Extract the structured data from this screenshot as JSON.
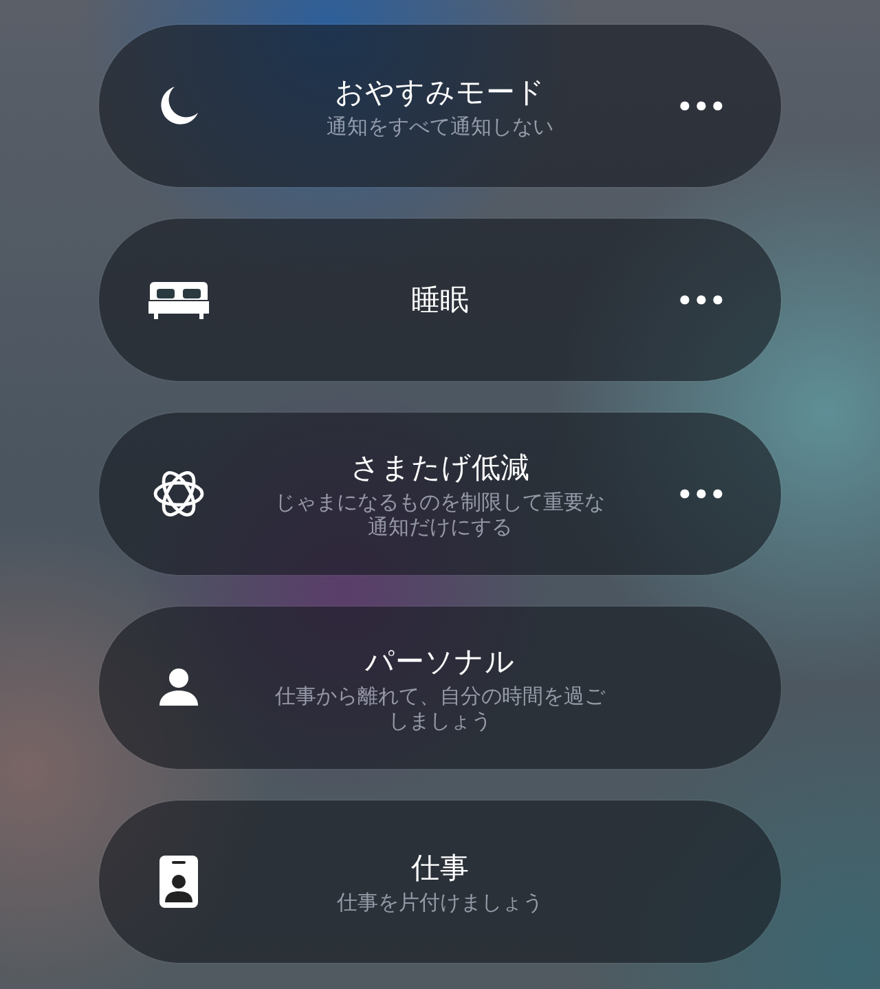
{
  "focus_modes": [
    {
      "kind": "moon",
      "title": "おやすみモード",
      "subtitle": "通知をすべて通知しない",
      "more_button": true
    },
    {
      "kind": "bed",
      "title": "睡眠",
      "more_button": true
    },
    {
      "kind": "atom",
      "title": "さまたげ低減",
      "subtitle": "じゃまになるものを制限して重要な通知だけにする",
      "more_button": true
    },
    {
      "kind": "person",
      "title": "パーソナル",
      "subtitle": "仕事から離れて、自分の時間を過ごしましょう",
      "more_button": false
    },
    {
      "kind": "badge",
      "title": "仕事",
      "subtitle": "仕事を片付けましょう",
      "more_button": false
    }
  ]
}
